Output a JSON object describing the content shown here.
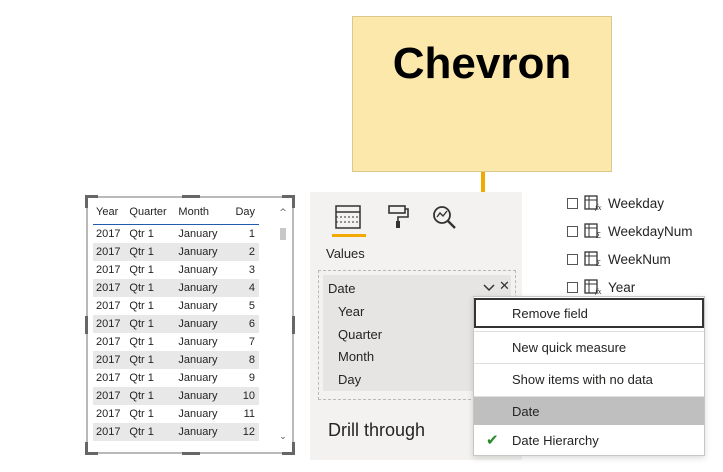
{
  "callout": {
    "text": "Chevron"
  },
  "table": {
    "columns": [
      "Year",
      "Quarter",
      "Month",
      "Day"
    ],
    "rows": [
      [
        "2017",
        "Qtr 1",
        "January",
        "1"
      ],
      [
        "2017",
        "Qtr 1",
        "January",
        "2"
      ],
      [
        "2017",
        "Qtr 1",
        "January",
        "3"
      ],
      [
        "2017",
        "Qtr 1",
        "January",
        "4"
      ],
      [
        "2017",
        "Qtr 1",
        "January",
        "5"
      ],
      [
        "2017",
        "Qtr 1",
        "January",
        "6"
      ],
      [
        "2017",
        "Qtr 1",
        "January",
        "7"
      ],
      [
        "2017",
        "Qtr 1",
        "January",
        "8"
      ],
      [
        "2017",
        "Qtr 1",
        "January",
        "9"
      ],
      [
        "2017",
        "Qtr 1",
        "January",
        "10"
      ],
      [
        "2017",
        "Qtr 1",
        "January",
        "11"
      ],
      [
        "2017",
        "Qtr 1",
        "January",
        "12"
      ]
    ]
  },
  "viz_pane": {
    "tabs": [
      "fields-tab-icon",
      "format-paint-roller-icon",
      "analytics-magnifier-icon"
    ],
    "values_label": "Values",
    "field_well": {
      "title": "Date",
      "subfields": [
        "Year",
        "Quarter",
        "Month",
        "Day"
      ],
      "chevron_icon": "chevron-down-icon",
      "remove_icon": "close-icon"
    },
    "drill_through_label": "Drill through"
  },
  "fields_list": [
    "Weekday",
    "WeekdayNum",
    "WeekNum",
    "Year"
  ],
  "context_menu": {
    "items": [
      "Remove field",
      "New quick measure",
      "Show items with no data",
      "Date",
      "Date Hierarchy"
    ],
    "checked": "Date Hierarchy"
  },
  "colors": {
    "accent": "#f2a900",
    "callout_bg": "#fbe8aa",
    "header_line": "#1f5cab",
    "check": "#228b22"
  }
}
